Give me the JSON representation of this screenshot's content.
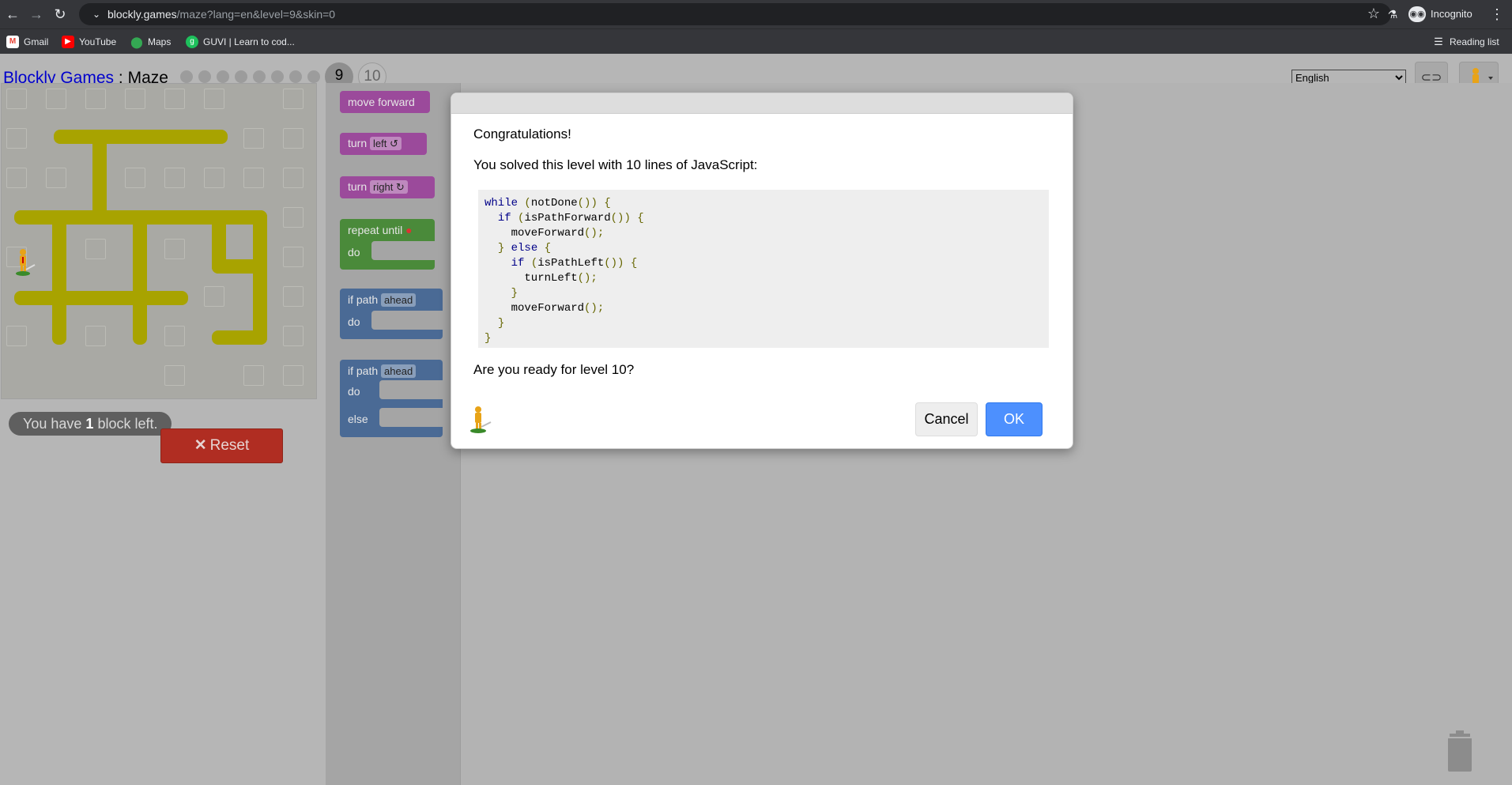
{
  "browser": {
    "url_host": "blockly.games",
    "url_path": "/maze?lang=en&level=9&skin=0",
    "profile_label": "Incognito",
    "bookmarks": [
      "Gmail",
      "YouTube",
      "Maps",
      "GUVI | Learn to cod..."
    ],
    "reading_list": "Reading list"
  },
  "header": {
    "app_name": "Blockly Games",
    "separator": ":",
    "game_name": "Maze",
    "current_level": "9",
    "next_level": "10",
    "language": "English",
    "language_options": [
      "English"
    ]
  },
  "maze": {
    "blocks_left_prefix": "You have ",
    "blocks_left_count": "1",
    "blocks_left_suffix": " block left."
  },
  "reset": {
    "label": "Reset"
  },
  "toolbox": {
    "move_forward": "move forward",
    "turn_left_label": "turn",
    "turn_left_value": "left ↺",
    "turn_right_label": "turn",
    "turn_right_value": "right ↻",
    "repeat_until": "repeat until",
    "do": "do",
    "if_path": "if path",
    "ahead": "ahead",
    "else": "else"
  },
  "dialog": {
    "title": "Congratulations!",
    "message": "You solved this level with 10 lines of JavaScript:",
    "code": [
      "while (notDone()) {",
      "  if (isPathForward()) {",
      "    moveForward();",
      "  } else {",
      "    if (isPathLeft()) {",
      "      turnLeft();",
      "    }",
      "    moveForward();",
      "  }",
      "}"
    ],
    "question": "Are you ready for level 10?",
    "cancel_label": "Cancel",
    "ok_label": "OK"
  },
  "colors": {
    "ok_button": "#4d90fe",
    "reset_button": "#b02d22",
    "maze_path": "#b9b500",
    "move_block": "#9b4a9b",
    "repeat_block": "#4a8a3a",
    "if_block": "#4a6a95"
  }
}
